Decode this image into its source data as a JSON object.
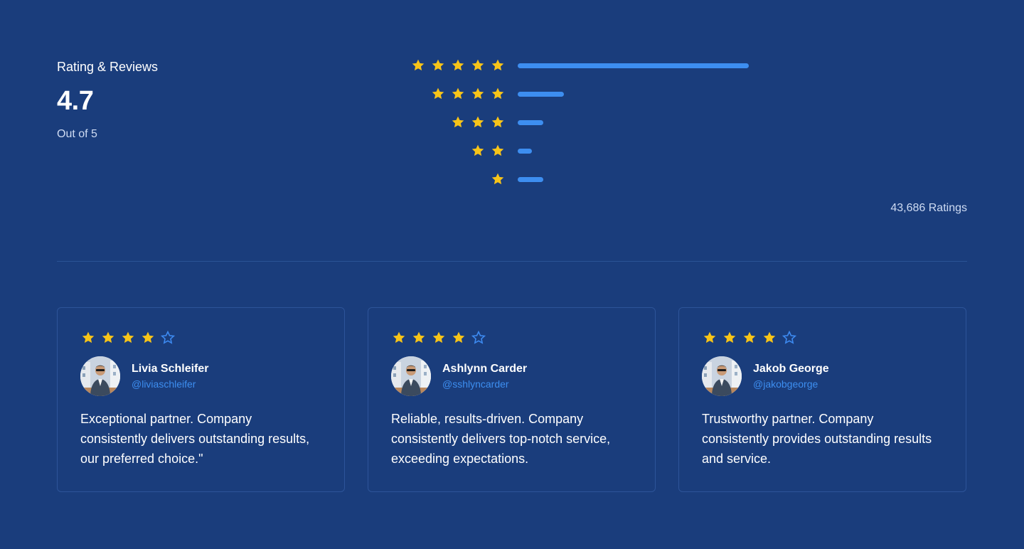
{
  "summary": {
    "title": "Rating & Reviews",
    "score": "4.7",
    "subtitle": "Out of 5"
  },
  "distribution": [
    {
      "stars": 5,
      "share": 1.0
    },
    {
      "stars": 4,
      "share": 0.2
    },
    {
      "stars": 3,
      "share": 0.11
    },
    {
      "stars": 2,
      "share": 0.06
    },
    {
      "stars": 1,
      "share": 0.11
    }
  ],
  "total_label": "43,686 Ratings",
  "colors": {
    "background": "#1a3d7c",
    "star": "#f7c419",
    "accent": "#3d8ef0",
    "border": "#2d5499"
  },
  "reviews": [
    {
      "rating": 4,
      "name": "Livia Schleifer",
      "handle": "@liviaschleifer",
      "text": "Exceptional partner. Company consistently delivers outstanding results, our preferred choice.\""
    },
    {
      "rating": 4,
      "name": "Ashlynn Carder",
      "handle": "@sshlyncarder",
      "text": "Reliable, results-driven. Company consistently delivers top-notch service, exceeding expectations."
    },
    {
      "rating": 4,
      "name": "Jakob George",
      "handle": "@jakobgeorge",
      "text": "Trustworthy partner. Company consistently provides outstanding results and service."
    }
  ],
  "icons": {
    "star_filled": "star-filled-icon",
    "star_outline": "star-outline-icon"
  }
}
